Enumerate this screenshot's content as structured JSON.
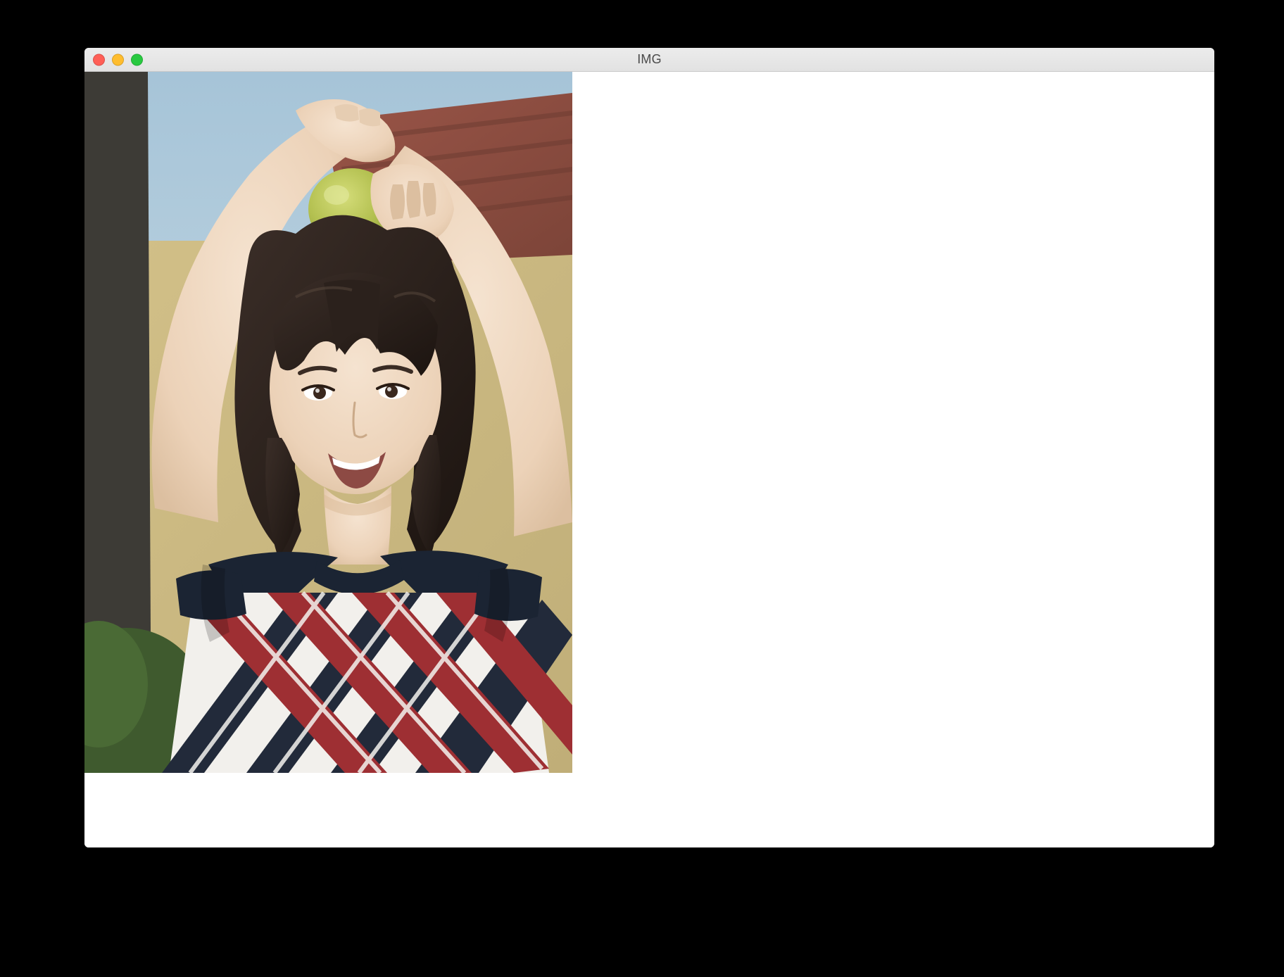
{
  "window": {
    "title": "IMG"
  },
  "content": {
    "image_description": "portrait-photo-woman-with-apple-on-head"
  }
}
